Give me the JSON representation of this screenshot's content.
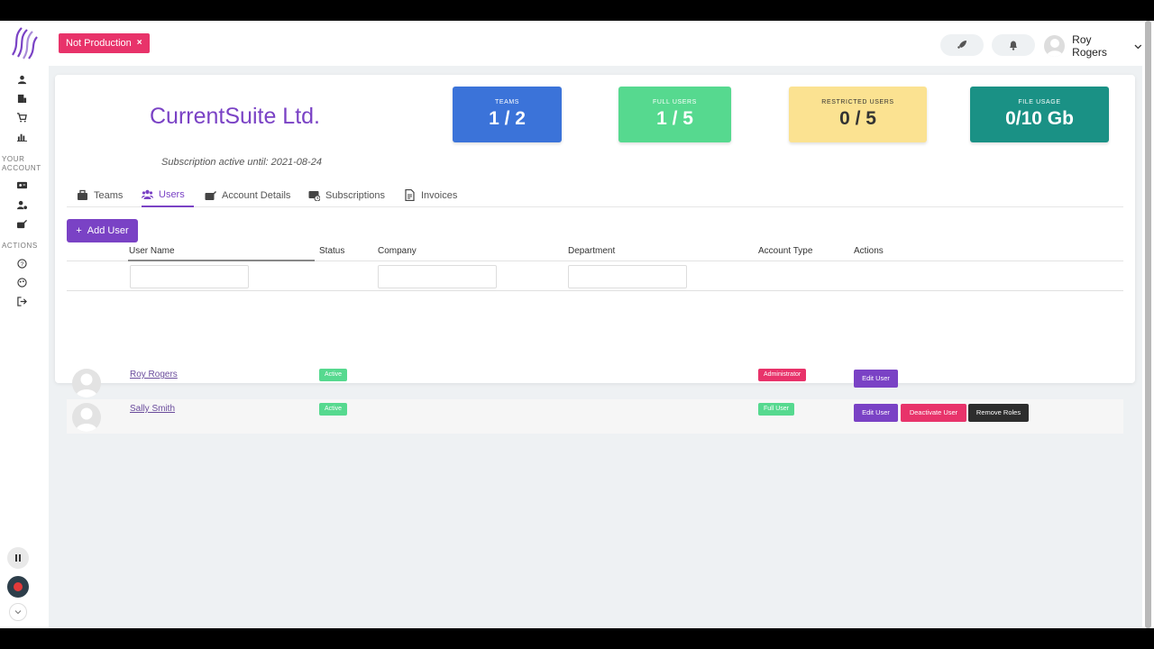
{
  "env": {
    "label": "Not Production",
    "close": "×"
  },
  "user_menu": {
    "name": "Roy Rogers"
  },
  "sidebar": {
    "section_account": "YOUR ACCOUNT",
    "section_actions": "ACTIONS"
  },
  "company": {
    "name": "CurrentSuite Ltd.",
    "subscription": "Subscription active until: 2021-08-24"
  },
  "stats": [
    {
      "label": "TEAMS",
      "value": "1 / 2",
      "color": "#3b73d9"
    },
    {
      "label": "FULL USERS",
      "value": "1 / 5",
      "color": "#56d98f"
    },
    {
      "label": "RESTRICTED USERS",
      "value": "0 / 5",
      "color": "#fbe291"
    },
    {
      "label": "FILE USAGE",
      "value": "0/10 Gb",
      "color": "#1a9185"
    }
  ],
  "tabs": [
    {
      "label": "Teams"
    },
    {
      "label": "Users"
    },
    {
      "label": "Account Details"
    },
    {
      "label": "Subscriptions"
    },
    {
      "label": "Invoices"
    }
  ],
  "add_user_label": "Add User",
  "table": {
    "columns": [
      "User Name",
      "Status",
      "Company",
      "Department",
      "Account Type",
      "Actions"
    ],
    "rows": [
      {
        "name": "Roy Rogers",
        "status": "Active",
        "company": "",
        "department": "",
        "account_type": "Administrator",
        "actions": [
          "Edit User"
        ]
      },
      {
        "name": "Sally Smith",
        "status": "Active",
        "company": "",
        "department": "",
        "account_type": "Full User",
        "actions": [
          "Edit User",
          "Deactivate User",
          "Remove Roles"
        ]
      }
    ]
  },
  "colors": {
    "brand": "#7a42c5",
    "danger": "#e8336a",
    "success": "#56d98f",
    "dark": "#2d2d2d"
  }
}
